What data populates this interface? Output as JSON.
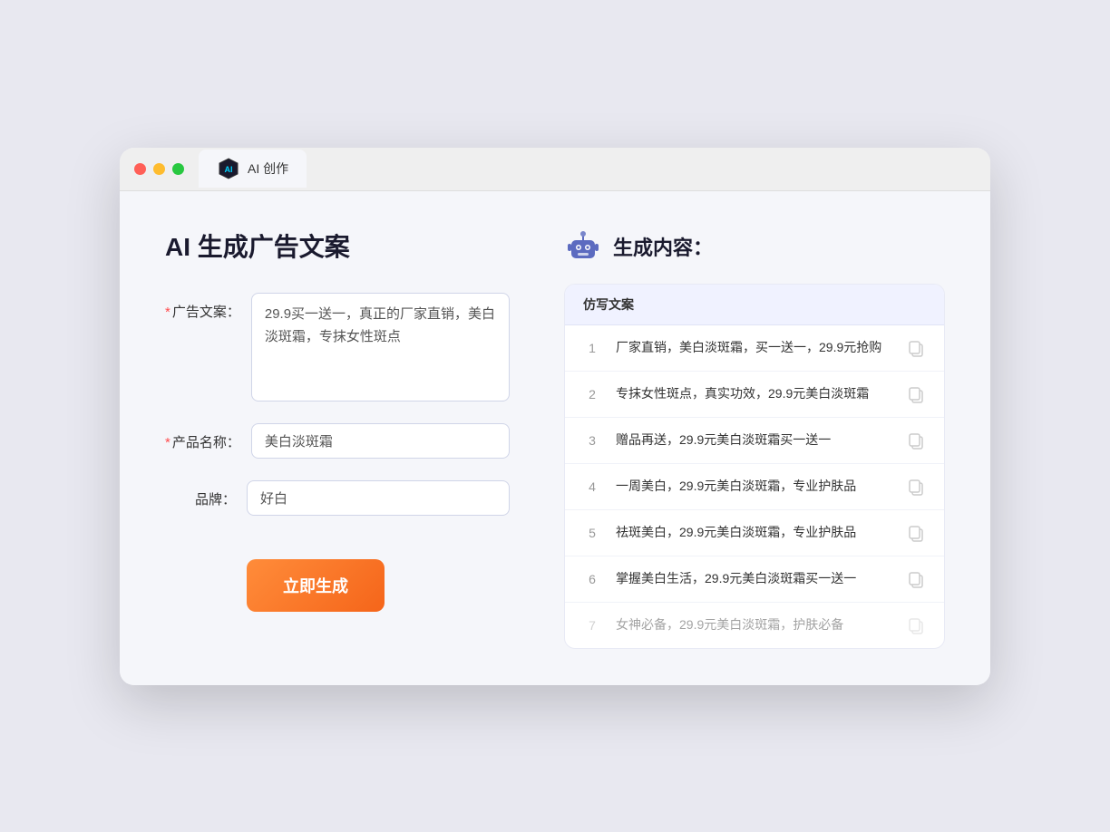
{
  "browser": {
    "tab_label": "AI 创作"
  },
  "page": {
    "title": "AI 生成广告文案",
    "right_title": "生成内容："
  },
  "form": {
    "ad_copy_label": "广告文案：",
    "ad_copy_required": "*",
    "ad_copy_value": "29.9买一送一，真正的厂家直销，美白淡斑霜，专抹女性斑点",
    "product_name_label": "产品名称：",
    "product_name_required": "*",
    "product_name_value": "美白淡斑霜",
    "brand_label": "品牌：",
    "brand_value": "好白",
    "generate_btn_label": "立即生成"
  },
  "results": {
    "column_header": "仿写文案",
    "items": [
      {
        "num": "1",
        "text": "厂家直销，美白淡斑霜，买一送一，29.9元抢购",
        "faded": false
      },
      {
        "num": "2",
        "text": "专抹女性斑点，真实功效，29.9元美白淡斑霜",
        "faded": false
      },
      {
        "num": "3",
        "text": "赠品再送，29.9元美白淡斑霜买一送一",
        "faded": false
      },
      {
        "num": "4",
        "text": "一周美白，29.9元美白淡斑霜，专业护肤品",
        "faded": false
      },
      {
        "num": "5",
        "text": "祛斑美白，29.9元美白淡斑霜，专业护肤品",
        "faded": false
      },
      {
        "num": "6",
        "text": "掌握美白生活，29.9元美白淡斑霜买一送一",
        "faded": false
      },
      {
        "num": "7",
        "text": "女神必备，29.9元美白淡斑霜，护肤必备",
        "faded": true
      }
    ]
  }
}
